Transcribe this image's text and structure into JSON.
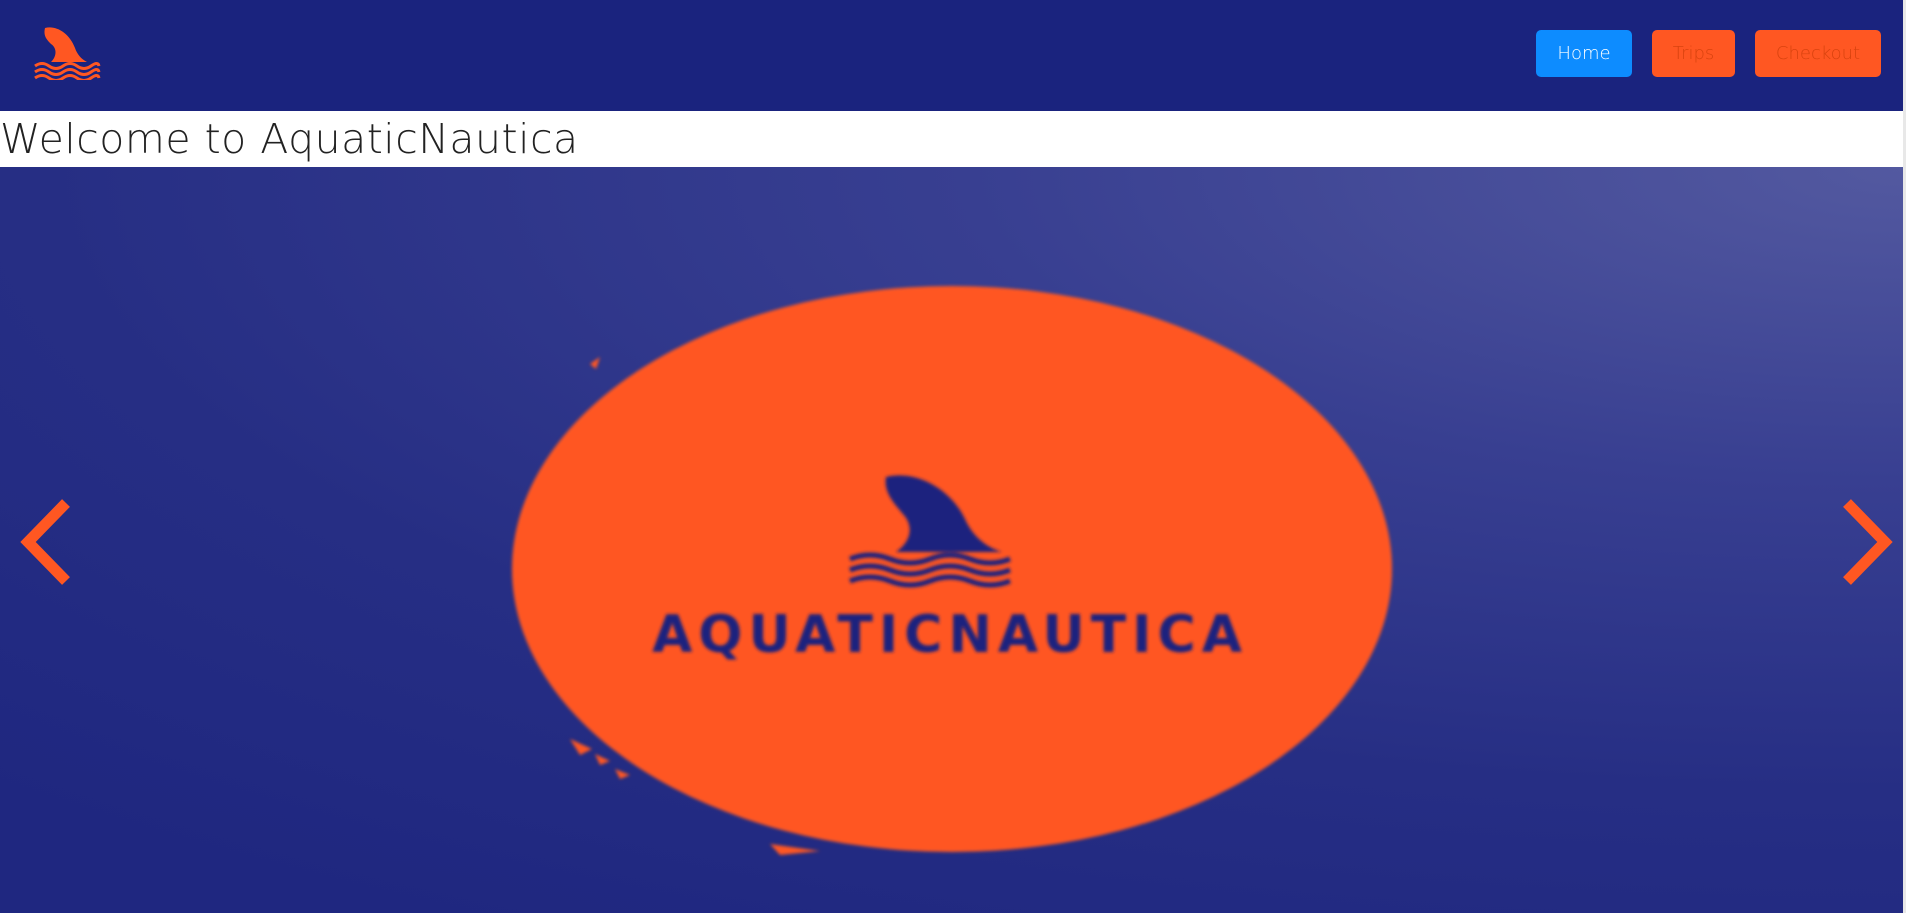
{
  "site": {
    "title": "Welcome to AquaticNautica",
    "logo_icon": "shark-fin-waves-icon"
  },
  "nav": {
    "items": [
      {
        "label": "Home",
        "state": "active"
      },
      {
        "label": "Trips",
        "state": "inactive"
      },
      {
        "label": "Checkout",
        "state": "inactive"
      }
    ]
  },
  "carousel": {
    "slide_brand_text": "AQUATICNAUTICA",
    "prev_icon": "chevron-left-icon",
    "next_icon": "chevron-right-icon"
  },
  "colors": {
    "navy": "#1a237e",
    "orange": "#ff5722",
    "active_blue": "#0d8cff"
  }
}
